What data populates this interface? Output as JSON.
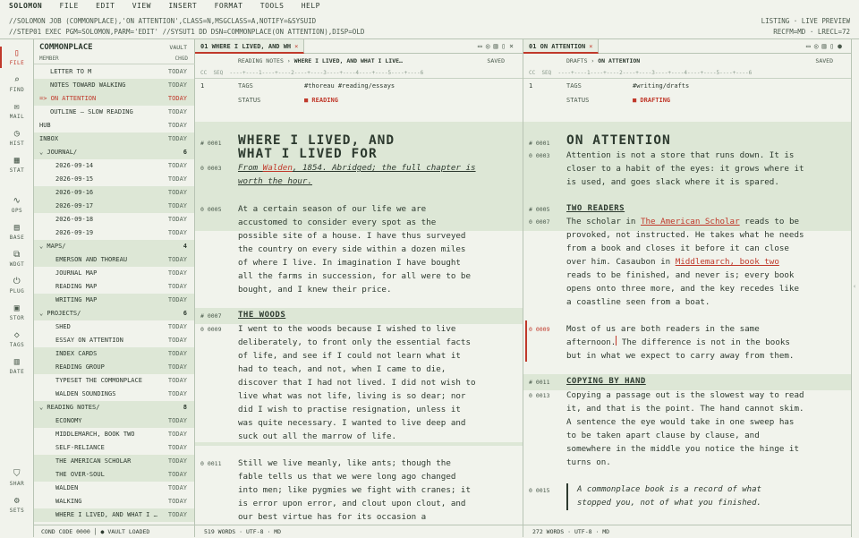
{
  "menu": {
    "app": "SOLOMON",
    "items": [
      "FILE",
      "EDIT",
      "VIEW",
      "INSERT",
      "FORMAT",
      "TOOLS",
      "HELP"
    ]
  },
  "jcl": {
    "line1": "//SOLOMON  JOB (COMMONPLACE),'ON ATTENTION',CLASS=N,MSGCLASS=A,NOTIFY=&SYSUID",
    "line2": "//STEP01   EXEC PGM=SOLOMON,PARM='EDIT'   //SYSUT1   DD DSN=COMMONPLACE(ON ATTENTION),DISP=OLD",
    "right1": "LISTING · LIVE PREVIEW",
    "right2": "RECFM=MD · LRECL=72"
  },
  "rail": [
    {
      "g": "▯",
      "l": "FILE"
    },
    {
      "g": "⌕",
      "l": "FIND"
    },
    {
      "g": "✉",
      "l": "MAIL"
    },
    {
      "g": "◷",
      "l": "HIST"
    },
    {
      "g": "▦",
      "l": "STAT"
    },
    {
      "g": "∿",
      "l": "OPS"
    },
    {
      "g": "▤",
      "l": "BASE"
    },
    {
      "g": "⧉",
      "l": "WDGT"
    },
    {
      "g": "⏻",
      "l": "PLUG"
    },
    {
      "g": "▣",
      "l": "STOR"
    },
    {
      "g": "◇",
      "l": "TAGS"
    },
    {
      "g": "▥",
      "l": "DATE"
    },
    {
      "g": "⛉",
      "l": "SHAR"
    },
    {
      "g": "⚙",
      "l": "SETS"
    }
  ],
  "tree": {
    "title": "COMMONPLACE",
    "vault": "VAULT",
    "col_member": "MEMBER",
    "col_chgd": "CHGD",
    "footer": "COND CODE 0000  │ ● VAULT LOADED",
    "rows": [
      {
        "t": "LETTER TO M",
        "c": "TODAY",
        "i": 3
      },
      {
        "t": "NOTES TOWARD WALKING",
        "c": "TODAY",
        "i": 3
      },
      {
        "t": "=> ON ATTENTION",
        "c": "TODAY",
        "i": 1,
        "sel": true
      },
      {
        "t": "OUTLINE — SLOW READING",
        "c": "TODAY",
        "i": 3
      },
      {
        "t": "HUB",
        "c": "TODAY",
        "i": 1
      },
      {
        "t": "INBOX",
        "c": "TODAY",
        "i": 1
      },
      {
        "t": "⌄ JOURNAL/",
        "c": "6",
        "i": 1,
        "f": true
      },
      {
        "t": "2026-09-14",
        "c": "TODAY",
        "i": 4
      },
      {
        "t": "2026-09-15",
        "c": "TODAY",
        "i": 4
      },
      {
        "t": "2026-09-16",
        "c": "TODAY",
        "i": 4
      },
      {
        "t": "2026-09-17",
        "c": "TODAY",
        "i": 4
      },
      {
        "t": "2026-09-18",
        "c": "TODAY",
        "i": 4
      },
      {
        "t": "2026-09-19",
        "c": "TODAY",
        "i": 4
      },
      {
        "t": "⌄ MAPS/",
        "c": "4",
        "i": 1,
        "f": true
      },
      {
        "t": "EMERSON AND THOREAU",
        "c": "TODAY",
        "i": 4
      },
      {
        "t": "JOURNAL MAP",
        "c": "TODAY",
        "i": 4
      },
      {
        "t": "READING MAP",
        "c": "TODAY",
        "i": 4
      },
      {
        "t": "WRITING MAP",
        "c": "TODAY",
        "i": 4
      },
      {
        "t": "⌄ PROJECTS/",
        "c": "6",
        "i": 1,
        "f": true
      },
      {
        "t": "SHED",
        "c": "TODAY",
        "i": 4
      },
      {
        "t": "ESSAY ON ATTENTION",
        "c": "TODAY",
        "i": 4
      },
      {
        "t": "INDEX CARDS",
        "c": "TODAY",
        "i": 4
      },
      {
        "t": "READING GROUP",
        "c": "TODAY",
        "i": 4
      },
      {
        "t": "TYPESET THE COMMONPLACE",
        "c": "TODAY",
        "i": 4
      },
      {
        "t": "WALDEN SOUNDINGS",
        "c": "TODAY",
        "i": 4
      },
      {
        "t": "⌄ READING NOTES/",
        "c": "8",
        "i": 1,
        "f": true
      },
      {
        "t": "ECONOMY",
        "c": "TODAY",
        "i": 4
      },
      {
        "t": "MIDDLEMARCH, BOOK TWO",
        "c": "TODAY",
        "i": 4
      },
      {
        "t": "SELF-RELIANCE",
        "c": "TODAY",
        "i": 4
      },
      {
        "t": "THE AMERICAN SCHOLAR",
        "c": "TODAY",
        "i": 4
      },
      {
        "t": "THE OVER-SOUL",
        "c": "TODAY",
        "i": 4
      },
      {
        "t": "WALDEN",
        "c": "TODAY",
        "i": 4
      },
      {
        "t": "WALKING",
        "c": "TODAY",
        "i": 4
      },
      {
        "t": "WHERE I LIVED, AND WHAT I …",
        "c": "TODAY",
        "i": 4
      }
    ]
  },
  "left": {
    "tab": "01 WHERE I LIVED, AND WH",
    "crumb_a": "READING NOTES",
    "crumb_b": "WHERE I LIVED, AND WHAT I LIVE…",
    "saved": "SAVED",
    "ruler": "CC  SEQ  ----+----1----+----2----+----3----+----4----+----5----+----6",
    "tags_k": "TAGS",
    "tags_v": "#thoreau   #reading/essays",
    "status_k": "STATUS",
    "status_v": "■ READING",
    "h1a": "WHERE I LIVED, AND",
    "h1b": "WHAT I LIVED FOR",
    "sub_pre": "From ",
    "sub_link": "Walden",
    "sub_post": ", 1854. Abridged; the full chapter is",
    "sub2": "worth the hour.",
    "p1": [
      "At a certain season of our life we are",
      "accustomed to consider every spot as the",
      "possible site of a house. I have thus surveyed",
      "the country on every side within a dozen miles",
      "of where I live. In imagination I have bought",
      "all the farms in succession, for all were to be",
      "bought, and I knew their price."
    ],
    "h2": "THE WOODS",
    "p2": [
      "I went to the woods because I wished to live",
      "deliberately, to front only the essential facts",
      "of life, and see if I could not learn what it",
      "had to teach, and not, when I came to die,",
      "discover that I had not lived. I did not wish to",
      "live what was not life, living is so dear; nor",
      "did I wish to practise resignation, unless it",
      "was quite necessary. I wanted to live deep and",
      "suck out all the marrow of life."
    ],
    "p3": [
      "Still we live meanly, like ants; though the",
      "fable tells us that we were long ago changed",
      "into men; like pygmies we fight with cranes; it",
      "is error upon error, and clout upon clout, and",
      "our best virtue has for its occasion a"
    ],
    "words": "519 WORDS  ·  UTF-8  ·  MD",
    "ln": {
      "meta": "1",
      "h": "# 0001",
      "sub": "0 0003",
      "p1": "0 0005",
      "h2": "# 0007",
      "p2": "0 0009",
      "p3": "0 0011"
    }
  },
  "right": {
    "tab": "01 ON ATTENTION",
    "crumb_a": "DRAFTS",
    "crumb_b": "ON ATTENTION",
    "saved": "SAVED",
    "ruler": "CC  SEQ  ----+----1----+----2----+----3----+----4----+----5----+----6",
    "tags_k": "TAGS",
    "tags_v": "#writing/drafts",
    "status_k": "STATUS",
    "status_v": "■ DRAFTING",
    "h1": "ON ATTENTION",
    "p1": [
      "Attention is not a store that runs down. It is",
      "closer to a habit of the eyes: it grows where it",
      "is used, and goes slack where it is spared."
    ],
    "h2a": "TWO READERS",
    "p2_1a": "The scholar in ",
    "p2_1l": "The American Scholar",
    "p2_1b": " reads to be",
    "p2": [
      "provoked, not instructed. He takes what he needs",
      "from a book and closes it before it can close"
    ],
    "p2_4a": "over him. Casaubon in ",
    "p2_4l": "Middlemarch, book two",
    "p2b": [
      "reads to be finished, and never is; every book",
      "opens onto three more, and the key recedes like",
      "a coastline seen from a boat."
    ],
    "p3a": "Most of us are both readers in the same",
    "p3b1": "afternoon.",
    "p3b2": " The difference is not in the books",
    "p3c": "but in what we expect to carry away from them.",
    "h2b": "COPYING BY HAND",
    "p4": [
      "Copying a passage out is the slowest way to read",
      "it, and that is the point. The hand cannot skim.",
      "A sentence the eye would take in one sweep has",
      "to be taken apart clause by clause, and",
      "somewhere in the middle you notice the hinge it",
      "turns on."
    ],
    "quote": [
      "A commonplace book is a record of what",
      "stopped you, not of what you finished."
    ],
    "words": "272 WORDS  ·  UTF-8  ·  MD",
    "ln": {
      "meta": "1",
      "h": "# 0001",
      "p1": "0 0003",
      "h2a": "# 0005",
      "p2": "0 0007",
      "p3": "0 0009",
      "h2b": "# 0011",
      "p4": "0 0013",
      "q": "0 0015"
    }
  }
}
